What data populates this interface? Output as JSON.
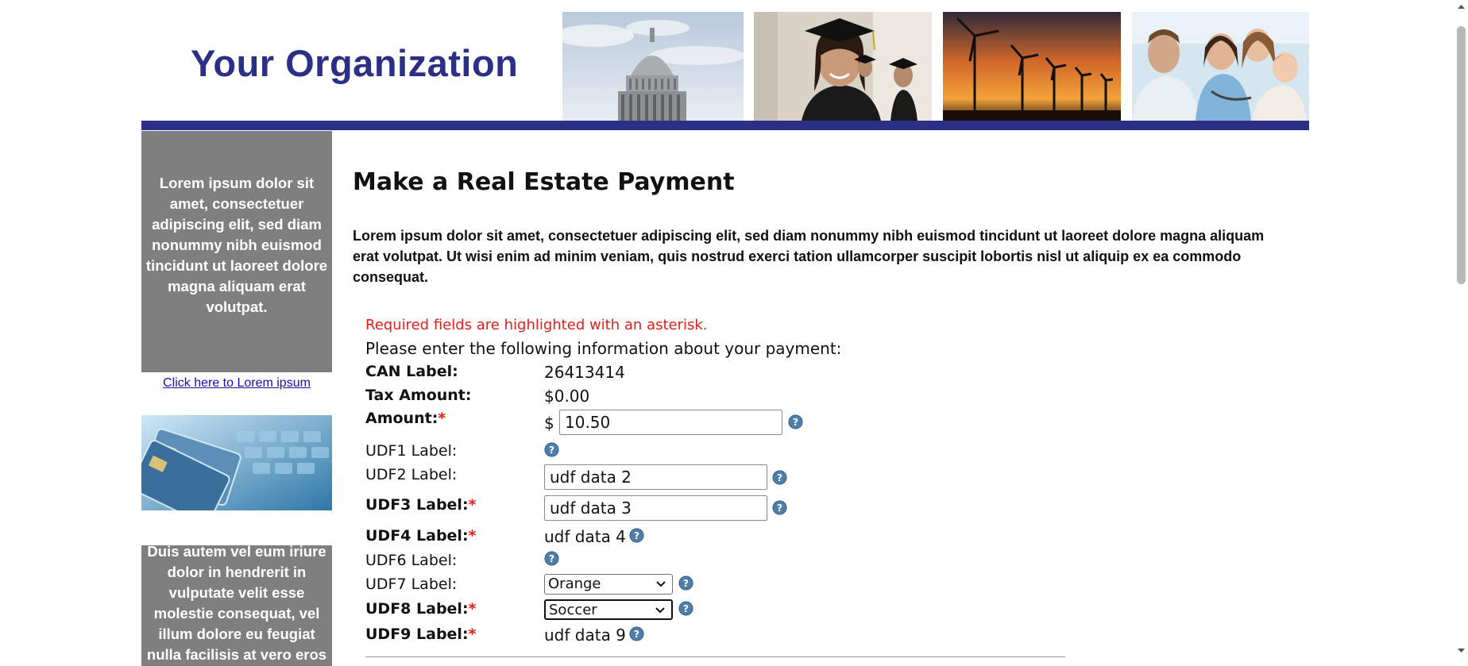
{
  "header": {
    "org_title": "Your Organization",
    "photos": [
      "capitol-photo",
      "graduate-photo",
      "wind-turbines-photo",
      "doctor-family-photo"
    ],
    "brand_color": "#2b2f86"
  },
  "sidebar": {
    "text_1": "Lorem ipsum dolor sit amet, consectetuer adipiscing elit, sed diam nonummy nibh euismod tincidunt ut laoreet dolore magna aliquam erat volutpat.",
    "link_label": "Click here to Lorem ipsum",
    "photo": "credit-cards-keyboard-photo",
    "text_2": "Duis autem vel eum iriure dolor in hendrerit in vulputate velit esse molestie consequat, vel illum dolore eu feugiat nulla facilisis at vero eros"
  },
  "main": {
    "title": "Make a Real Estate Payment",
    "intro": "Lorem ipsum dolor sit amet, consectetuer adipiscing elit, sed diam nonummy nibh euismod tincidunt ut laoreet dolore magna aliquam erat volutpat. Ut wisi enim ad minim veniam, quis nostrud exerci tation ullamcorper suscipit lobortis nisl ut aliquip ex ea commodo consequat.",
    "required_note": "Required fields are highlighted with an asterisk.",
    "instructions": "Please enter the following information about your payment:",
    "required_marker": "*",
    "fields": {
      "can": {
        "label": "CAN Label:",
        "value": "26413414"
      },
      "tax_amount": {
        "label": "Tax Amount:",
        "value": "$0.00"
      },
      "amount": {
        "label": "Amount:",
        "currency": "$",
        "value": "10.50"
      },
      "udf1": {
        "label": "UDF1 Label:"
      },
      "udf2": {
        "label": "UDF2 Label:",
        "value": "udf data 2"
      },
      "udf3": {
        "label": "UDF3 Label:",
        "value": "udf data 3"
      },
      "udf4": {
        "label": "UDF4 Label:",
        "value": "udf data 4"
      },
      "udf6": {
        "label": "UDF6 Label:"
      },
      "udf7": {
        "label": "UDF7 Label:",
        "selected": "Orange"
      },
      "udf8": {
        "label": "UDF8 Label:",
        "selected": "Soccer"
      },
      "udf9": {
        "label": "UDF9 Label:",
        "value": "udf data 9"
      }
    },
    "icon_help": "help-question-icon"
  },
  "colors": {
    "required_red": "#e0201b",
    "sidebar_gray": "#7f7f7f",
    "link_blue": "#1a0dab"
  }
}
